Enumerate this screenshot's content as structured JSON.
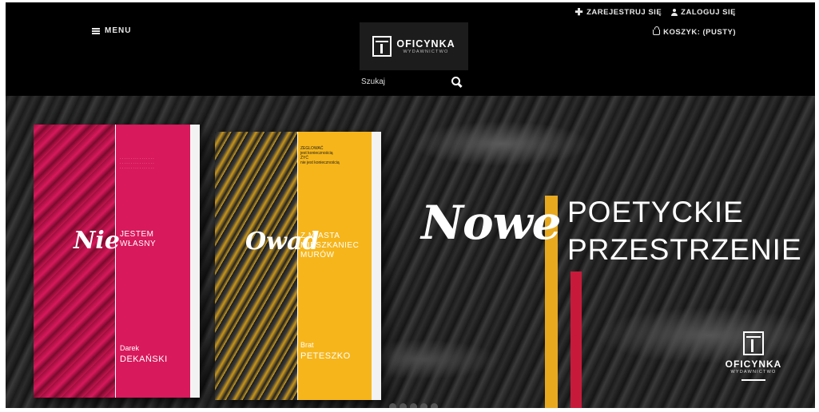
{
  "header": {
    "menu_label": "MENU",
    "register_label": "ZAREJESTRUJ SIĘ",
    "login_label": "ZALOGUJ SIĘ",
    "cart_label": "KOSZYK: (PUSTY)",
    "logo_title": "OFICYNKA",
    "logo_subtitle": "WYDAWNICTWO",
    "search_placeholder": "Szukaj"
  },
  "banner": {
    "script_word": "Nowe",
    "headline_line1": "POETYCKIE",
    "headline_line2": "PRZESTRZENIE",
    "logo_title": "OFICYNKA",
    "logo_subtitle": "WYDAWNICTWO",
    "books": [
      {
        "script_word": "Nie",
        "title_line1": "JESTEM",
        "title_line2": "WŁASNY",
        "author_first": "Darek",
        "author_last": "DEKAŃSKI"
      },
      {
        "script_word": "Owad",
        "top_text_line1": "ZEGLOWAĆ",
        "top_text_line2": "jest koniecznością",
        "top_text_line3": "ŻYĆ",
        "top_text_line4": "nie jest koniecznością",
        "title_line1": "Z MIASTA",
        "title_line2": "MIESZKANIEC",
        "title_line3": "MURÓW",
        "author_first": "Brat",
        "author_last": "PETESZKO"
      }
    ],
    "carousel_dots": 5
  },
  "colors": {
    "book1": "#d8195c",
    "book2": "#f6b51a",
    "stripe_yellow": "#e8a91f",
    "stripe_red": "#c71a3a"
  }
}
